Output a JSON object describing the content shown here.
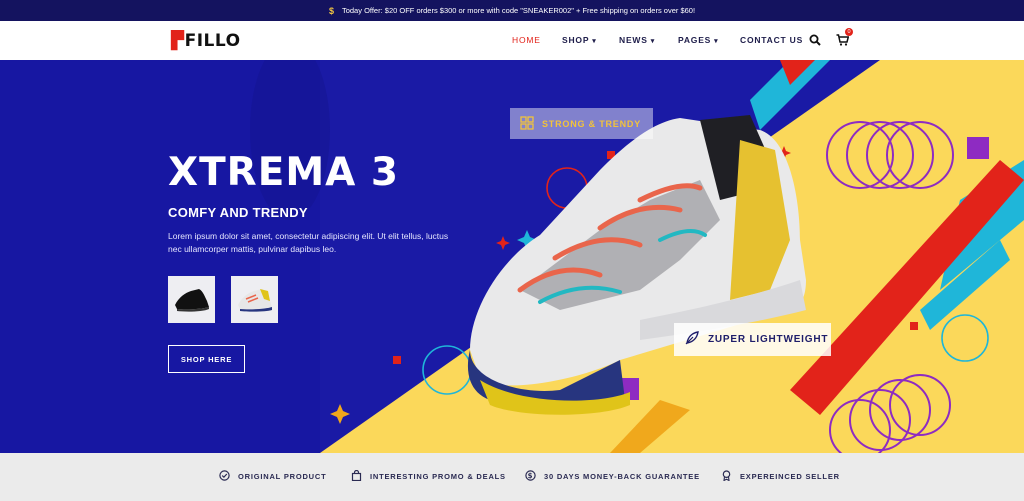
{
  "topbar": {
    "dollar": "$",
    "offer": "Today Offer: $20 OFF orders $300 or more with code \"SNEAKER002\" + Free shipping on orders over $60!"
  },
  "header": {
    "logo": "FILLO",
    "nav": [
      {
        "label": "HOME",
        "caret": ""
      },
      {
        "label": "SHOP",
        "caret": "▾"
      },
      {
        "label": "NEWS",
        "caret": "▾"
      },
      {
        "label": "PAGES",
        "caret": "▾"
      },
      {
        "label": "CONTACT US",
        "caret": ""
      }
    ],
    "cart_count": "0",
    "icons": [
      "search-icon",
      "cart-icon"
    ]
  },
  "hero": {
    "title": "XTREMA 3",
    "subtitle": "COMFY AND TRENDY",
    "text": "Lorem ipsum dolor sit amet, consectetur adipiscing elit. Ut elit tellus, luctus nec ullamcorper mattis, pulvinar dapibus leo.",
    "shop_button": "SHOP HERE",
    "tag_strong": "STRONG & TRENDY",
    "tag_zuper": "ZUPER LIGHTWEIGHT"
  },
  "features": [
    {
      "label": "ORIGINAL PRODUCT",
      "icon": "check-circle-icon"
    },
    {
      "label": "INTERESTING PROMO & DEALS",
      "icon": "shopping-bag-icon"
    },
    {
      "label": "30 DAYS MONEY-BACK GUARANTEE",
      "icon": "money-back-icon"
    },
    {
      "label": "EXPEREINCED SELLER",
      "icon": "award-icon"
    }
  ],
  "colors": {
    "navy": "#14135f",
    "hero_blue": "#1a1aa5",
    "yellow": "#fbd85a",
    "red": "#e2231a",
    "cyan": "#1fb6d9",
    "purple": "#7b2fb5"
  }
}
